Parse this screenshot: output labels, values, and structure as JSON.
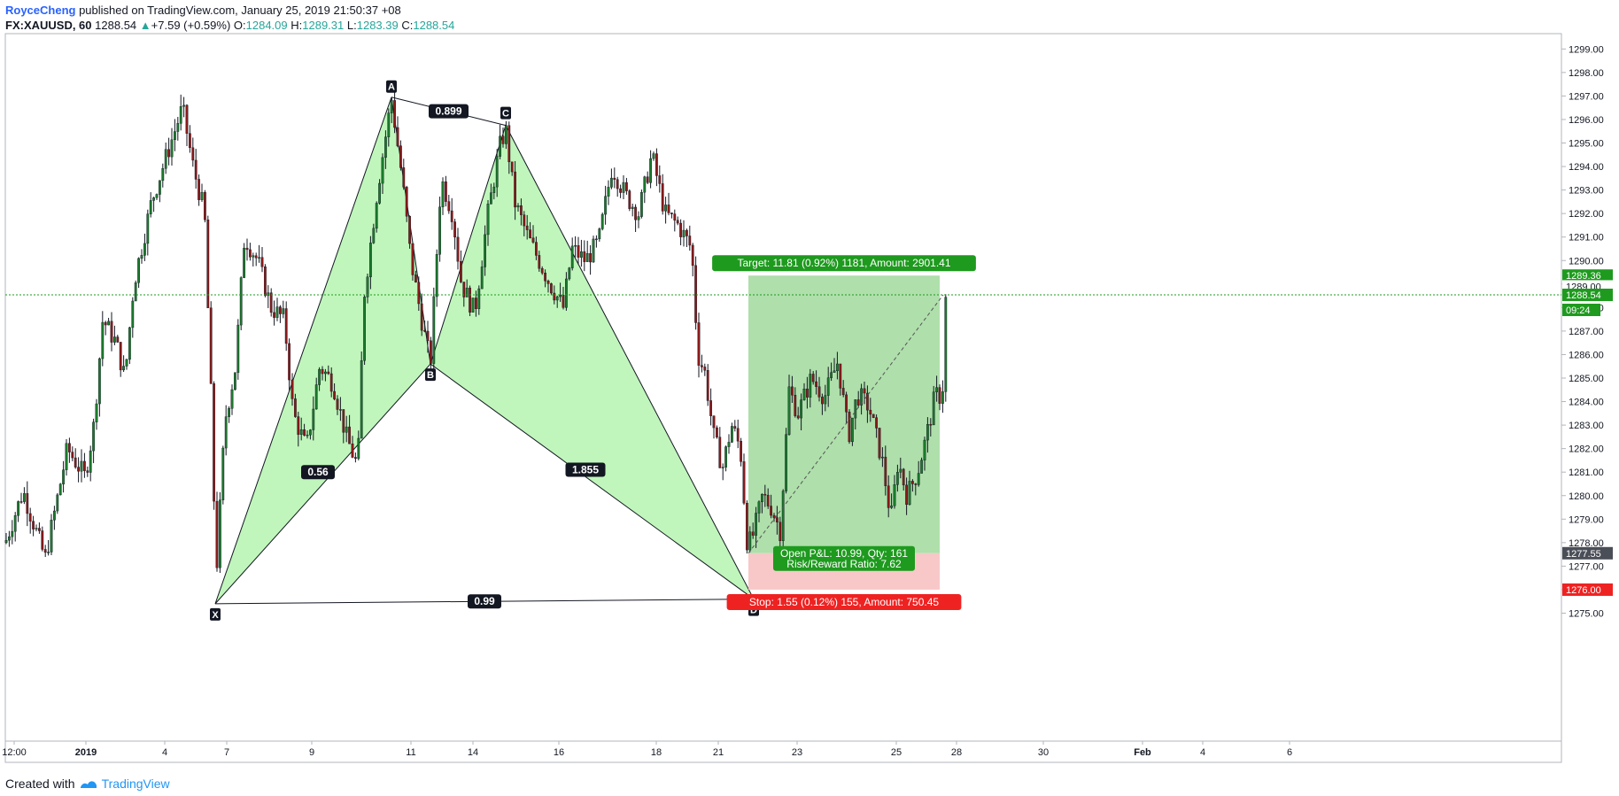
{
  "header": {
    "author": "RoyceCheng",
    "published_text": " published on TradingView.com, January 25, 2019 21:50:37 +08",
    "symbol": "FX:XAUUSD, 60",
    "last": "1288.54",
    "change": "+7.59 (+0.59%)",
    "open_label": "O:",
    "open": "1284.09",
    "high_label": "H:",
    "high": "1289.31",
    "low_label": "L:",
    "low": "1283.39",
    "close_label": "C:",
    "close": "1288.54"
  },
  "footer": {
    "created_with": "Created with",
    "brand": "TradingView"
  },
  "colors": {
    "up": "#26a69a",
    "down": "#ef5350",
    "wick": "#131722",
    "pattern_fill": "#b9f5b4",
    "target_zone": "#a6dca2",
    "stop_zone": "#f8c8c8",
    "target_label": "#1e9a1e",
    "stop_label": "#ef2222",
    "price_line": "#1e9a1e"
  },
  "chart_data": {
    "type": "candlestick",
    "title": "",
    "ylim": [
      1274.2,
      1300.0
    ],
    "y_ticks": [
      1275,
      1276,
      1277,
      1278,
      1279,
      1280,
      1281,
      1282,
      1283,
      1284,
      1285,
      1286,
      1287,
      1288,
      1289,
      1290,
      1291,
      1292,
      1293,
      1294,
      1295,
      1296,
      1297,
      1298,
      1299
    ],
    "y_tick_labels": [
      "1275.00",
      "1276.00",
      "1277.00",
      "1278.00",
      "1279.00",
      "1280.00",
      "1281.00",
      "1282.00",
      "1283.00",
      "1284.00",
      "1285.00",
      "1286.00",
      "1287.00",
      "1288.00",
      "1289.00",
      "1290.00",
      "1291.00",
      "1292.00",
      "1293.00",
      "1294.00",
      "1295.00",
      "1296.00",
      "1297.00",
      "1298.00",
      "1299.00"
    ],
    "x_ticks": [
      "12:00",
      "2019",
      "4",
      "7",
      "9",
      "11",
      "14",
      "16",
      "18",
      "21",
      "23",
      "25",
      "28",
      "30",
      "Feb",
      "4",
      "6"
    ],
    "x_bold_ticks": [
      "2019",
      "Feb"
    ],
    "series": [
      {
        "name": "FX:XAUUSD",
        "anchors": [
          [
            0,
            1278.0
          ],
          [
            20,
            1280.2
          ],
          [
            45,
            1277.3
          ],
          [
            70,
            1282.0
          ],
          [
            90,
            1280.8
          ],
          [
            100,
            1283.0
          ],
          [
            110,
            1287.5
          ],
          [
            125,
            1286.5
          ],
          [
            135,
            1285.0
          ],
          [
            145,
            1289.0
          ],
          [
            165,
            1292.5
          ],
          [
            185,
            1294.8
          ],
          [
            200,
            1296.5
          ],
          [
            212,
            1294.0
          ],
          [
            225,
            1292.0
          ],
          [
            233,
            1283.5
          ],
          [
            238,
            1276.5
          ],
          [
            248,
            1283.2
          ],
          [
            260,
            1285.5
          ],
          [
            270,
            1291.0
          ],
          [
            285,
            1290.0
          ],
          [
            300,
            1288.0
          ],
          [
            315,
            1287.5
          ],
          [
            325,
            1283.5
          ],
          [
            340,
            1282.0
          ],
          [
            355,
            1285.5
          ],
          [
            370,
            1284.8
          ],
          [
            385,
            1282.5
          ],
          [
            398,
            1281.2
          ],
          [
            405,
            1288.5
          ],
          [
            420,
            1293.0
          ],
          [
            436,
            1296.9
          ],
          [
            448,
            1293.5
          ],
          [
            458,
            1290.0
          ],
          [
            470,
            1287.5
          ],
          [
            480,
            1285.6
          ],
          [
            492,
            1293.5
          ],
          [
            505,
            1292.0
          ],
          [
            515,
            1289.0
          ],
          [
            530,
            1287.8
          ],
          [
            545,
            1292.0
          ],
          [
            558,
            1294.8
          ],
          [
            565,
            1295.6
          ],
          [
            575,
            1292.5
          ],
          [
            590,
            1291.0
          ],
          [
            600,
            1290.2
          ],
          [
            615,
            1289.0
          ],
          [
            630,
            1288.0
          ],
          [
            640,
            1290.5
          ],
          [
            655,
            1290.0
          ],
          [
            670,
            1290.8
          ],
          [
            685,
            1294.0
          ],
          [
            700,
            1292.8
          ],
          [
            715,
            1292.0
          ],
          [
            730,
            1294.5
          ],
          [
            745,
            1292.0
          ],
          [
            760,
            1291.5
          ],
          [
            775,
            1290.5
          ],
          [
            782,
            1286.0
          ],
          [
            790,
            1285.2
          ],
          [
            800,
            1282.5
          ],
          [
            810,
            1281.2
          ],
          [
            820,
            1283.0
          ],
          [
            830,
            1282.0
          ],
          [
            838,
            1277.8
          ],
          [
            845,
            1278.4
          ],
          [
            855,
            1280.0
          ],
          [
            865,
            1279.5
          ],
          [
            875,
            1278.5
          ],
          [
            885,
            1284.5
          ],
          [
            895,
            1283.5
          ],
          [
            910,
            1285.0
          ],
          [
            925,
            1284.2
          ],
          [
            940,
            1285.7
          ],
          [
            952,
            1282.5
          ],
          [
            962,
            1284.3
          ],
          [
            975,
            1283.8
          ],
          [
            990,
            1281.5
          ],
          [
            1000,
            1279.0
          ],
          [
            1008,
            1281.5
          ],
          [
            1018,
            1280.0
          ],
          [
            1030,
            1281.0
          ],
          [
            1040,
            1282.5
          ],
          [
            1050,
            1284.3
          ],
          [
            1058,
            1284.2
          ],
          [
            1062,
            1288.54
          ]
        ]
      }
    ],
    "annotations": {
      "harmonic_pattern": {
        "points": [
          {
            "label": "X",
            "px": 237,
            "price": 1275.4
          },
          {
            "label": "A",
            "px": 436,
            "price": 1296.95
          },
          {
            "label": "B",
            "px": 480,
            "price": 1285.6
          },
          {
            "label": "C",
            "px": 565,
            "price": 1295.75
          },
          {
            "label": "D",
            "px": 845,
            "price": 1275.6
          }
        ],
        "ratios": [
          {
            "text": "0.899"
          },
          {
            "text": "0.56"
          },
          {
            "text": "1.855"
          },
          {
            "text": "0.99"
          }
        ]
      },
      "position": {
        "target_text": "Target: 11.81 (0.92%) 1181, Amount: 2901.41",
        "stop_text": "Stop: 1.55 (0.12%) 155, Amount: 750.45",
        "pnl_text": "Open P&L: 10.99, Qty: 161",
        "rr_text": "Risk/Reward Ratio: 7.62",
        "entry": 1277.55,
        "target": 1289.36,
        "stop": 1276.0
      },
      "price_labels": [
        {
          "text": "1289.36",
          "price": 1289.36,
          "style": "green"
        },
        {
          "text": "1289.00",
          "price": 1288.9,
          "style": "plain"
        },
        {
          "text": "1288.54",
          "price": 1288.54,
          "style": "green"
        },
        {
          "text": "09:24",
          "price": 1287.9,
          "style": "green"
        },
        {
          "text": "1277.55",
          "price": 1277.55,
          "style": "gray"
        },
        {
          "text": "1276.00",
          "price": 1276.0,
          "style": "red"
        }
      ]
    }
  }
}
